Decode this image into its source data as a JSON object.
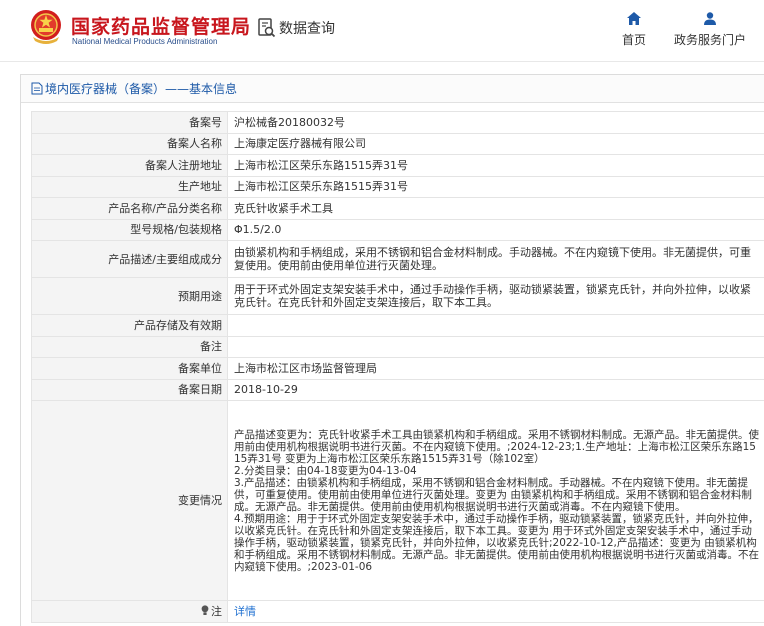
{
  "header": {
    "site_title": "国家药品监督管理局",
    "site_title_en": "National Medical Products Administration",
    "query_label": "数据查询",
    "nav": [
      {
        "label": "首页",
        "icon": "home-icon"
      },
      {
        "label": "政务服务门户",
        "icon": "user-icon"
      }
    ]
  },
  "breadcrumb": {
    "text": "境内医疗器械（备案）——基本信息",
    "icon": "document-icon"
  },
  "record": {
    "rows": [
      {
        "key": "备案号",
        "value": "沪松械备20180032号"
      },
      {
        "key": "备案人名称",
        "value": "上海康定医疗器械有限公司"
      },
      {
        "key": "备案人注册地址",
        "value": "上海市松江区荣乐东路1515弄31号"
      },
      {
        "key": "生产地址",
        "value": "上海市松江区荣乐东路1515弄31号"
      },
      {
        "key": "产品名称/产品分类名称",
        "value": "克氏针收紧手术工具"
      },
      {
        "key": "型号规格/包装规格",
        "value": "Φ1.5/2.0"
      },
      {
        "key": "产品描述/主要组成成分",
        "value": "由锁紧机构和手柄组成，采用不锈钢和铝合金材料制成。手动器械。不在内窥镜下使用。非无菌提供，可重复使用。使用前由使用单位进行灭菌处理。"
      },
      {
        "key": "预期用途",
        "value": "用于于环式外固定支架安装手术中，通过手动操作手柄，驱动锁紧装置，锁紧克氏针，并向外拉伸，以收紧克氏针。在克氏针和外固定支架连接后，取下本工具。"
      },
      {
        "key": "产品存储及有效期",
        "value": ""
      },
      {
        "key": "备注",
        "value": ""
      },
      {
        "key": "备案单位",
        "value": "上海市松江区市场监督管理局"
      },
      {
        "key": "备案日期",
        "value": "2018-10-29"
      }
    ],
    "change": {
      "key": "变更情况",
      "lines": [
        "产品描述变更为：克氏针收紧手术工具由锁紧机构和手柄组成。采用不锈钢材料制成。无源产品。非无菌提供。使用前由使用机构根据说明书进行灭菌。不在内窥镜下使用。;2024-12-23;1.生产地址：上海市松江区荣乐东路1515弄31号 变更为上海市松江区荣乐东路1515弄31号（除102室）",
        "2.分类目录：由04-18变更为04-13-04",
        "3.产品描述：由锁紧机构和手柄组成，采用不锈钢和铝合金材料制成。手动器械。不在内窥镜下使用。非无菌提供，可重复使用。使用前由使用单位进行灭菌处理。变更为 由锁紧机构和手柄组成。采用不锈钢和铝合金材料制成。无源产品。非无菌提供。使用前由使用机构根据说明书进行灭菌或消毒。不在内窥镜下使用。",
        "4.预期用途：用于于环式外固定支架安装手术中，通过手动操作手柄，驱动锁紧装置，锁紧克氏针，并向外拉伸，以收紧克氏针。在克氏针和外固定支架连接后，取下本工具。变更为 用于环式外固定支架安装手术中，通过手动操作手柄，驱动锁紧装置，锁紧克氏针，并向外拉伸，以收紧克氏针;2022-10-12,产品描述：变更为 由锁紧机构和手柄组成。采用不锈钢材料制成。无源产品。非无菌提供。使用前由使用机构根据说明书进行灭菌或消毒。不在内窥镜下使用。;2023-01-06"
      ]
    },
    "note": {
      "key": "注",
      "link": "详情"
    }
  },
  "colors": {
    "brand_red": "#c8161d",
    "link_blue": "#1e6fd0",
    "nav_blue": "#1e5aa8"
  }
}
